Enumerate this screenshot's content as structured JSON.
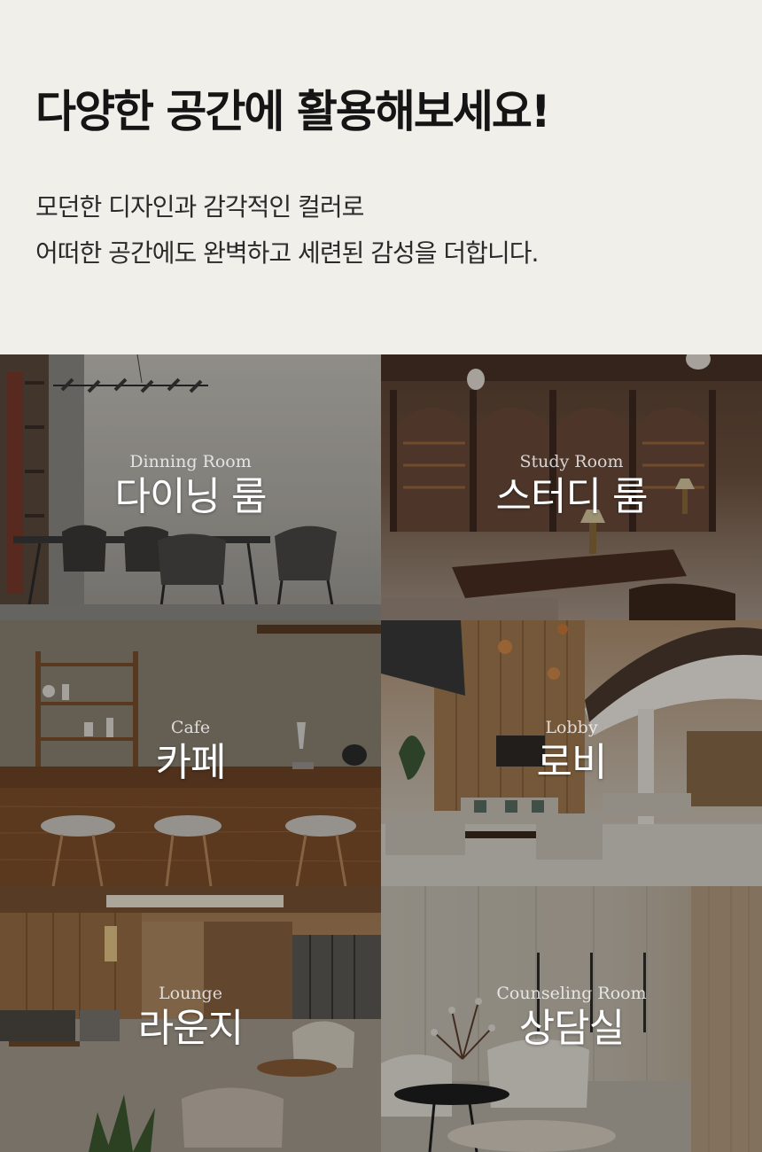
{
  "hero": {
    "title": "다양한 공간에 활용해보세요!",
    "lines": [
      "모던한 디자인과 감각적인 컬러로",
      "어떠한 공간에도 완벽하고 세련된 감성을 더합니다."
    ]
  },
  "tiles": [
    {
      "en": "Dinning Room",
      "ko": "다이닝 룸"
    },
    {
      "en": "Study Room",
      "ko": "스터디 룸"
    },
    {
      "en": "Cafe",
      "ko": "카페"
    },
    {
      "en": "Lobby",
      "ko": "로비"
    },
    {
      "en": "Lounge",
      "ko": "라운지"
    },
    {
      "en": "Counseling Room",
      "ko": "상담실"
    }
  ],
  "colors": {
    "background": "#f1efea",
    "title": "#151515",
    "label": "#ffffff"
  }
}
